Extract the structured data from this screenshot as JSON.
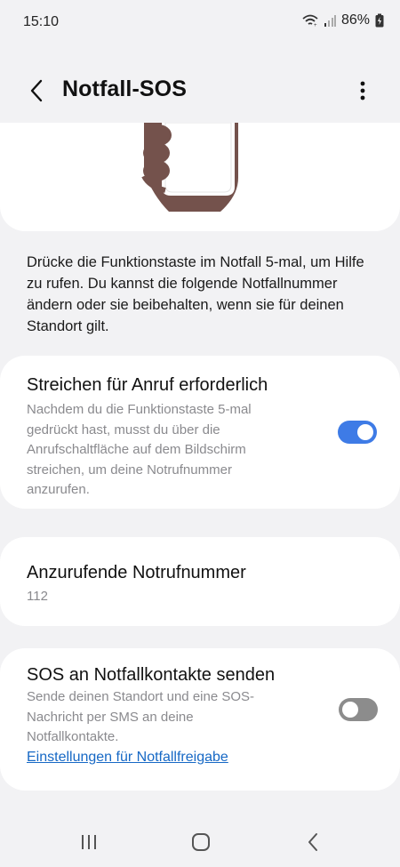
{
  "status": {
    "time": "15:10",
    "battery": "86%"
  },
  "header": {
    "title": "Notfall-SOS"
  },
  "intro": "Drücke die Funktionstaste im Notfall 5-mal, um Hilfe zu rufen. Du kannst die folgende Notfallnummer ändern oder sie beibehalten, wenn sie für deinen Standort gilt.",
  "swipe_setting": {
    "title": "Streichen für Anruf erforderlich",
    "description": "Nachdem du die Funktionstaste 5-mal gedrückt hast, musst du über die Anrufschaltfläche auf dem Bildschirm streichen, um deine Notrufnummer anzurufen.",
    "enabled": true
  },
  "number_setting": {
    "title": "Anzurufende Notrufnummer",
    "value": "112"
  },
  "contacts_setting": {
    "title": "SOS an Notfallkontakte senden",
    "description": "Sende deinen Standort und eine SOS-Nachricht per SMS an deine Notfallkontakte.",
    "link": "Einstellungen für Notfallfreigabe",
    "enabled": false
  },
  "colors": {
    "accent": "#3e7be6",
    "link": "#1668c5",
    "background": "#f2f2f4"
  }
}
